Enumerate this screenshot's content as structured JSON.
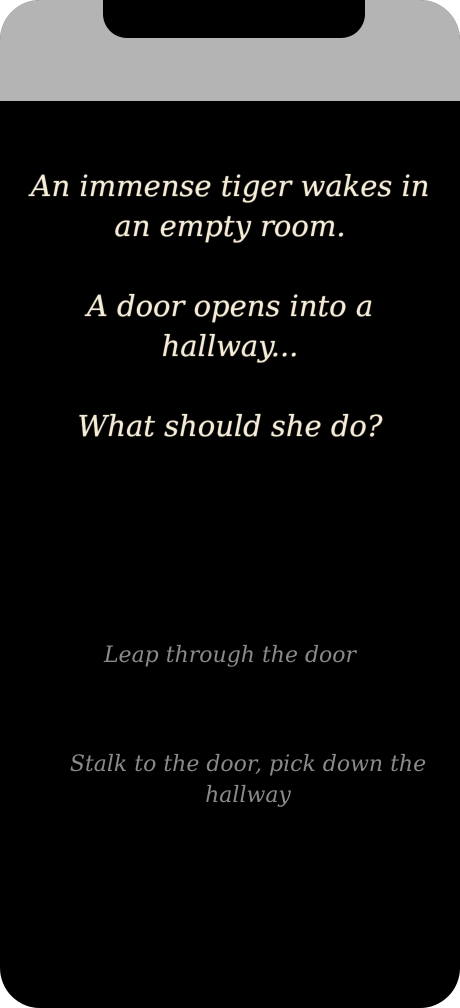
{
  "story": {
    "paragraphs": [
      "An immense tiger wakes in an empty room.",
      "A door opens into a hallway...",
      "What should she do?"
    ]
  },
  "choices": [
    "Leap through the door",
    "Stalk to the door, pick down the hallway"
  ],
  "colors": {
    "status_bar": "#b4b4b4",
    "background": "#000000",
    "story_text": "#f4ecd8",
    "choice_text": "#8a8a8a"
  }
}
